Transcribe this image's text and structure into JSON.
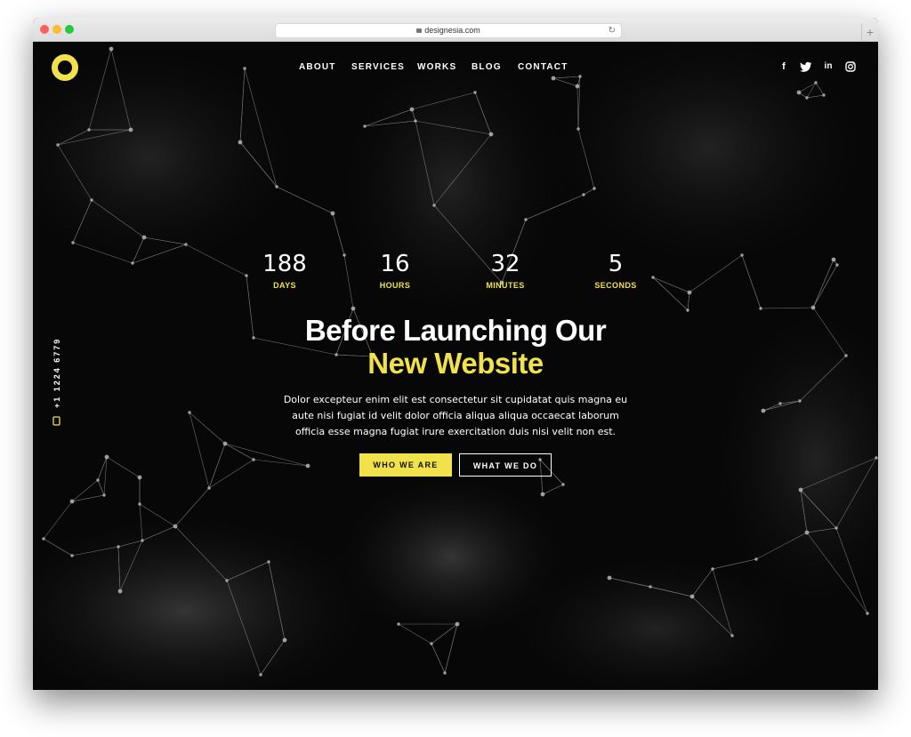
{
  "browser": {
    "url": "designesia.com"
  },
  "nav": {
    "items": [
      "ABOUT",
      "SERVICES",
      "WORKS",
      "BLOG",
      "CONTACT"
    ]
  },
  "social": [
    "facebook-icon",
    "twitter-icon",
    "linkedin-icon",
    "instagram-icon"
  ],
  "social_glyphs": {
    "facebook": "f",
    "linkedin": "in"
  },
  "phone": "+1 1224 6779",
  "countdown": [
    {
      "value": "188",
      "label": "DAYS"
    },
    {
      "value": "16",
      "label": "HOURS"
    },
    {
      "value": "32",
      "label": "MINUTES"
    },
    {
      "value": "5",
      "label": "SECONDS"
    }
  ],
  "headline": {
    "line1": "Before Launching Our",
    "line2": "New Website"
  },
  "description": {
    "line1": "Dolor excepteur enim elit est consectetur sit cupidatat quis magna eu",
    "line2": "aute nisi fugiat id velit dolor officia aliqua aliqua occaecat laborum",
    "line3": "officia esse magna fugiat irure exercitation duis nisi velit non est."
  },
  "buttons": {
    "primary": "WHO WE ARE",
    "secondary": "WHAT WE DO"
  },
  "colors": {
    "accent": "#f1e14b",
    "background": "#0b0b0b",
    "text": "#ffffff"
  }
}
